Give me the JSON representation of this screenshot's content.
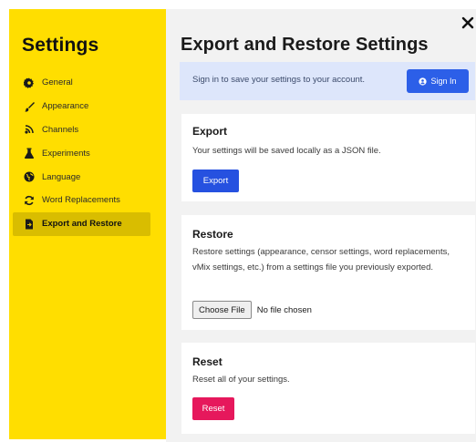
{
  "sidebar": {
    "title": "Settings",
    "items": [
      {
        "label": "General",
        "icon": "gear-icon"
      },
      {
        "label": "Appearance",
        "icon": "paintbrush-icon"
      },
      {
        "label": "Channels",
        "icon": "broadcast-icon"
      },
      {
        "label": "Experiments",
        "icon": "flask-icon"
      },
      {
        "label": "Language",
        "icon": "globe-icon"
      },
      {
        "label": "Word Replacements",
        "icon": "refresh-icon"
      },
      {
        "label": "Export and Restore",
        "icon": "file-export-icon",
        "active": true
      }
    ]
  },
  "main": {
    "title": "Export and Restore Settings",
    "close_icon": "close-icon"
  },
  "signin_banner": {
    "text": "Sign in to save your settings to your account.",
    "button_label": "Sign In"
  },
  "export": {
    "title": "Export",
    "description": "Your settings will be saved locally as a JSON file.",
    "button_label": "Export"
  },
  "restore": {
    "title": "Restore",
    "description": "Restore settings (appearance, censor settings, word replacements, vMix settings, etc.) from a settings file you previously exported.",
    "choose_file_label": "Choose File",
    "file_status": "No file chosen"
  },
  "reset": {
    "title": "Reset",
    "description": "Reset all of your settings.",
    "button_label": "Reset"
  },
  "colors": {
    "sidebar_bg": "#ffde00",
    "sidebar_active_bg": "#d9bd00",
    "primary_button": "#2651e0",
    "danger_button": "#e6185c",
    "banner_bg": "#dde6fb"
  }
}
